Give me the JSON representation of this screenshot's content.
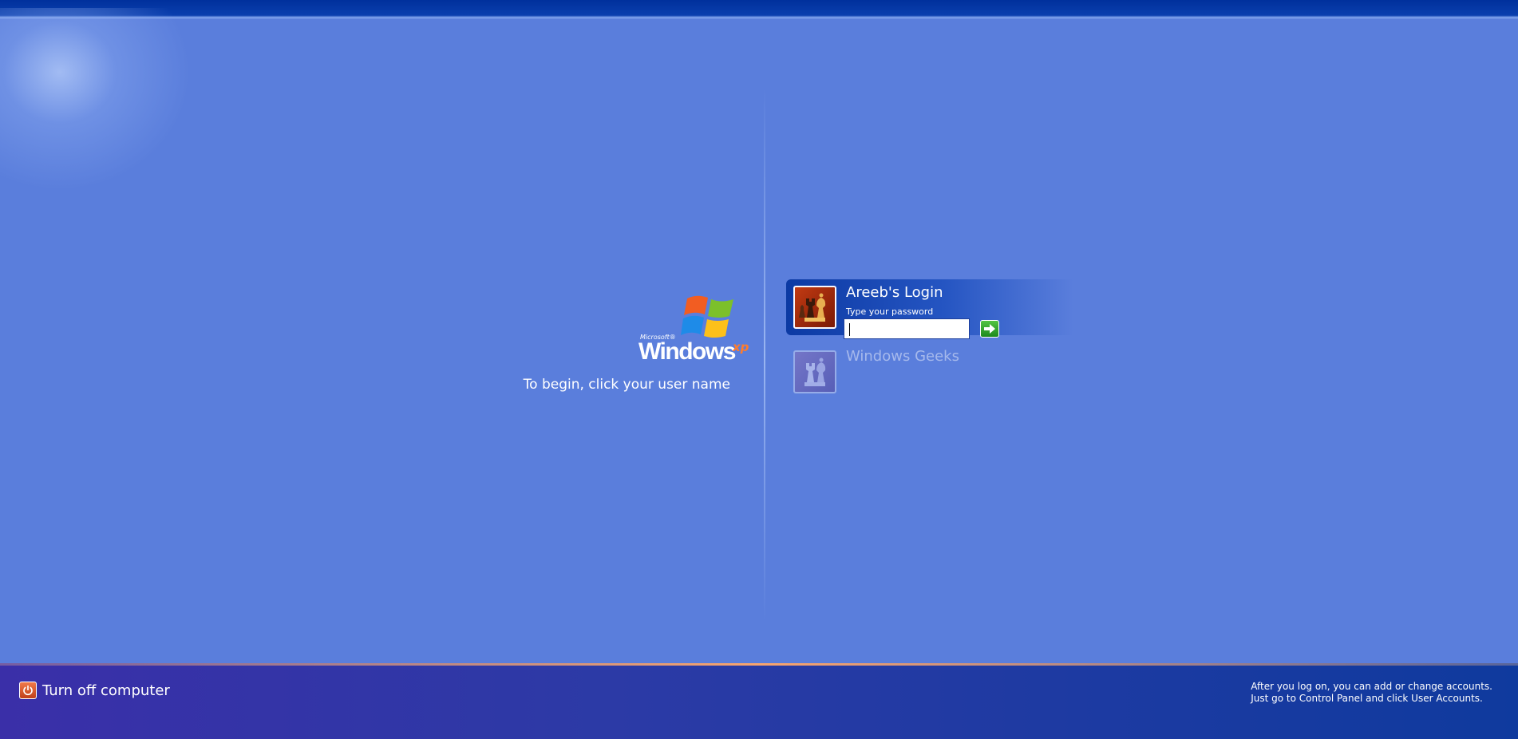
{
  "logo": {
    "microsoft": "Microsoft®",
    "windows": "Windows",
    "xp": "xp"
  },
  "instruction": "To begin, click your user name",
  "users": [
    {
      "name": "Areeb's Login",
      "selected": true,
      "password_hint": "Type your password",
      "password_value": "",
      "avatar": "chess-pieces-picture"
    },
    {
      "name": "Windows Geeks",
      "selected": false,
      "avatar": "chess-pieces-picture"
    }
  ],
  "bottom": {
    "turn_off_label": "Turn off computer",
    "info_line1": "After you log on, you can add or change accounts.",
    "info_line2": "Just go to Control Panel and click User Accounts."
  },
  "colors": {
    "background": "#5a7edc",
    "top_bar": "#00309c",
    "bottom_bar": "#2c3aa6",
    "accent_orange": "#f8a56e",
    "go_button": "#2f9e2f"
  },
  "icons": [
    "windows-flag-icon",
    "go-arrow-icon",
    "power-icon"
  ]
}
